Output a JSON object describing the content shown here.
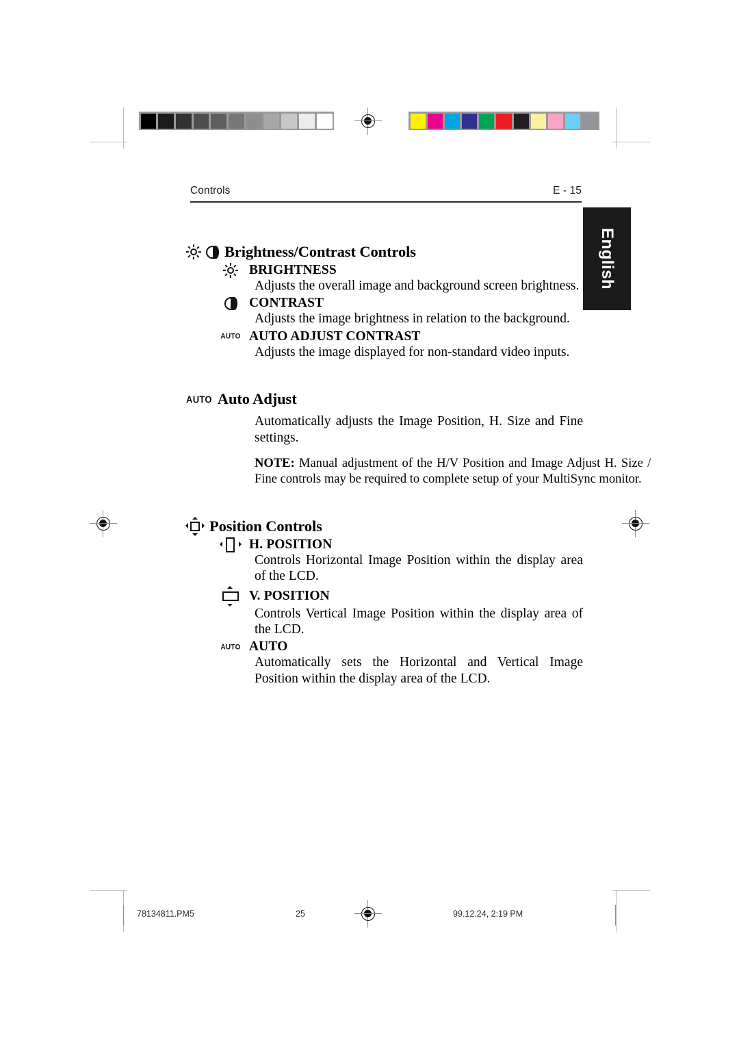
{
  "page": {
    "header_left": "Controls",
    "header_right": "E - 15",
    "language_tab": "English"
  },
  "printer_marks": {
    "grayscale_steps": [
      "#000000",
      "#1c1c1c",
      "#333333",
      "#4d4d4d",
      "#5e5e5e",
      "#777777",
      "#8e8e8e",
      "#a8a8a8",
      "#c8c8c8",
      "#ececec",
      "#ffffff"
    ],
    "color_steps": [
      "#fff200",
      "#ec008c",
      "#00a5e3",
      "#2e3192",
      "#00a551",
      "#ed1c24",
      "#231f20",
      "#fbf0a0",
      "#f7a4c6",
      "#6dcff6",
      "#939598"
    ],
    "registration_mark": "registration-crosshair"
  },
  "sections": [
    {
      "id": "brightness-contrast",
      "icons": [
        "brightness-sun-icon",
        "contrast-halfcircle-icon"
      ],
      "title": "Brightness/Contrast Controls",
      "entries": [
        {
          "icon": "brightness-sun-icon",
          "label": "BRIGHTNESS",
          "body": "Adjusts the overall image and background screen brightness."
        },
        {
          "icon": "contrast-halfcircle-icon",
          "label": "CONTRAST",
          "body": "Adjusts the image brightness in relation to the background."
        },
        {
          "icon": "auto-icon",
          "icon_text": "AUTO",
          "label": "AUTO ADJUST CONTRAST",
          "body": "Adjusts the image displayed for non-standard video inputs."
        }
      ]
    },
    {
      "id": "auto-adjust",
      "icons": [
        "auto-icon"
      ],
      "icon_text": "AUTO",
      "title": "Auto Adjust",
      "body": "Automatically adjusts the Image Position, H. Size and Fine settings.",
      "note_label": "NOTE:",
      "note_body": " Manual adjustment of the H/V Position and Image Adjust H. Size / Fine controls may be required to complete setup of your MultiSync monitor."
    },
    {
      "id": "position-controls",
      "icons": [
        "position-4way-icon"
      ],
      "title": "Position Controls",
      "entries": [
        {
          "icon": "h-position-icon",
          "label": "H. POSITION",
          "body": "Controls Horizontal Image Position within the display area of the LCD."
        },
        {
          "icon": "v-position-icon",
          "label": "V. POSITION",
          "body": "Controls Vertical Image Position within the display area of the LCD."
        },
        {
          "icon": "auto-icon",
          "icon_text": "AUTO",
          "label": "AUTO",
          "body": "Automatically sets the Horizontal and Vertical Image Position within the display area of the LCD."
        }
      ]
    }
  ],
  "footer": {
    "file": "78134811.PM5",
    "page_number": "25",
    "timestamp": "99.12.24, 2:19 PM"
  }
}
